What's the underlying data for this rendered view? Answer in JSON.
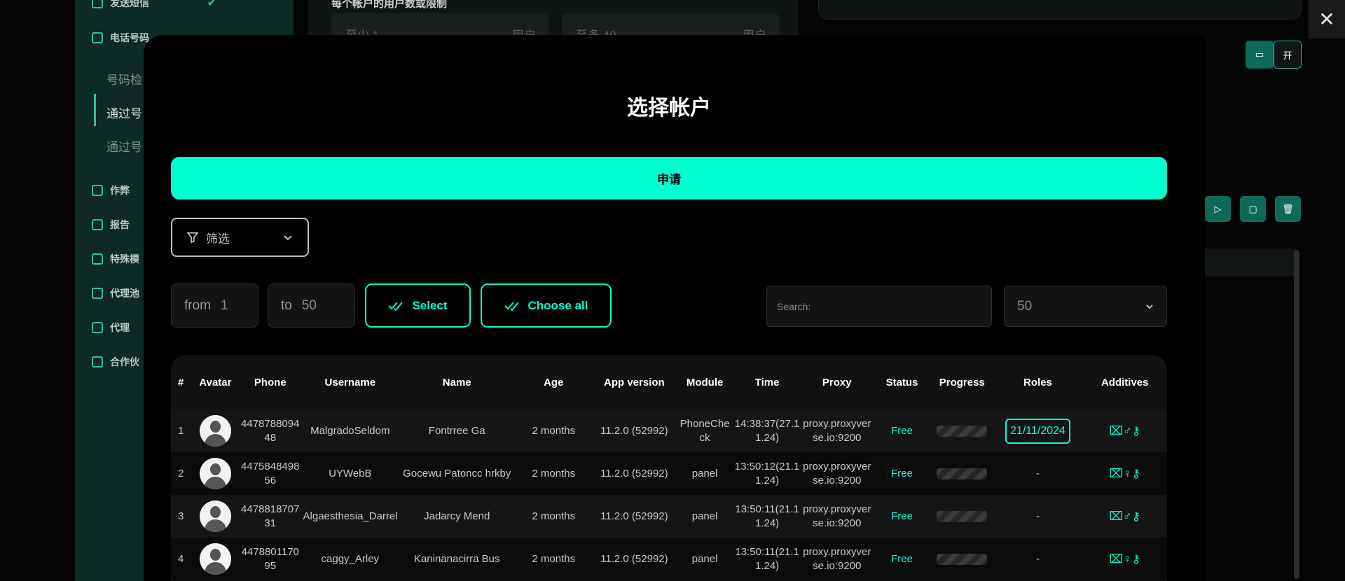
{
  "background": {
    "top_label": "每个帐户的用户数或限制",
    "sidebar": {
      "items": [
        "发送短信",
        "电话号码",
        "作弊",
        "报告",
        "特殊模",
        "代理池",
        "代理",
        "合作伙"
      ],
      "sub_items": [
        "号码检",
        "通过号",
        "通过号"
      ]
    },
    "fields": [
      {
        "placeholder": "至少 1",
        "unit": "用户"
      },
      {
        "placeholder": "至多 40",
        "unit": "用户"
      }
    ],
    "toggle_label": "开"
  },
  "modal": {
    "title": "选择帐户",
    "apply_label": "申请",
    "filter_label": "筛选",
    "from_label": "from",
    "from_value": "1",
    "to_label": "to",
    "to_value": "50",
    "select_label": "Select",
    "choose_all_label": "Choose all",
    "search_placeholder": "Search:",
    "per_page_value": "50"
  },
  "table": {
    "headers": [
      "#",
      "Avatar",
      "Phone",
      "Username",
      "Name",
      "Age",
      "App version",
      "Module",
      "Time",
      "Proxy",
      "Status",
      "Progress",
      "Roles",
      "Additives"
    ],
    "rows": [
      {
        "idx": "1",
        "phone": "447878809448",
        "username": "MalgradoSeldom",
        "name": "Fontrree Ga",
        "age": "2 months",
        "app": "11.2.0 (52992)",
        "module": "PhoneCheck",
        "time": "14:38:37(27.11.24)",
        "proxy": "proxy.proxyverse.io:9200",
        "status": "Free",
        "role": "21/11/2024",
        "additives": "⌧♂⚷"
      },
      {
        "idx": "2",
        "phone": "447584849856",
        "username": "UYWebB",
        "name": "Gocewu Patoncc hrkby",
        "age": "2 months",
        "app": "11.2.0 (52992)",
        "module": "panel",
        "time": "13:50:12(21.11.24)",
        "proxy": "proxy.proxyverse.io:9200",
        "status": "Free",
        "role": "-",
        "additives": "⌧♀⚷"
      },
      {
        "idx": "3",
        "phone": "447881870731",
        "username": "Algaesthesia_Darrel",
        "name": "Jadarcy Mend",
        "age": "2 months",
        "app": "11.2.0 (52992)",
        "module": "panel",
        "time": "13:50:11(21.11.24)",
        "proxy": "proxy.proxyverse.io:9200",
        "status": "Free",
        "role": "-",
        "additives": "⌧♂⚷"
      },
      {
        "idx": "4",
        "phone": "447880117095",
        "username": "caggy_Arley",
        "name": "Kaninanacirra Bus",
        "age": "2 months",
        "app": "11.2.0 (52992)",
        "module": "panel",
        "time": "13:50:11(21.11.24)",
        "proxy": "proxy.proxyverse.io:9200",
        "status": "Free",
        "role": "-",
        "additives": "⌧♀⚷"
      }
    ]
  }
}
